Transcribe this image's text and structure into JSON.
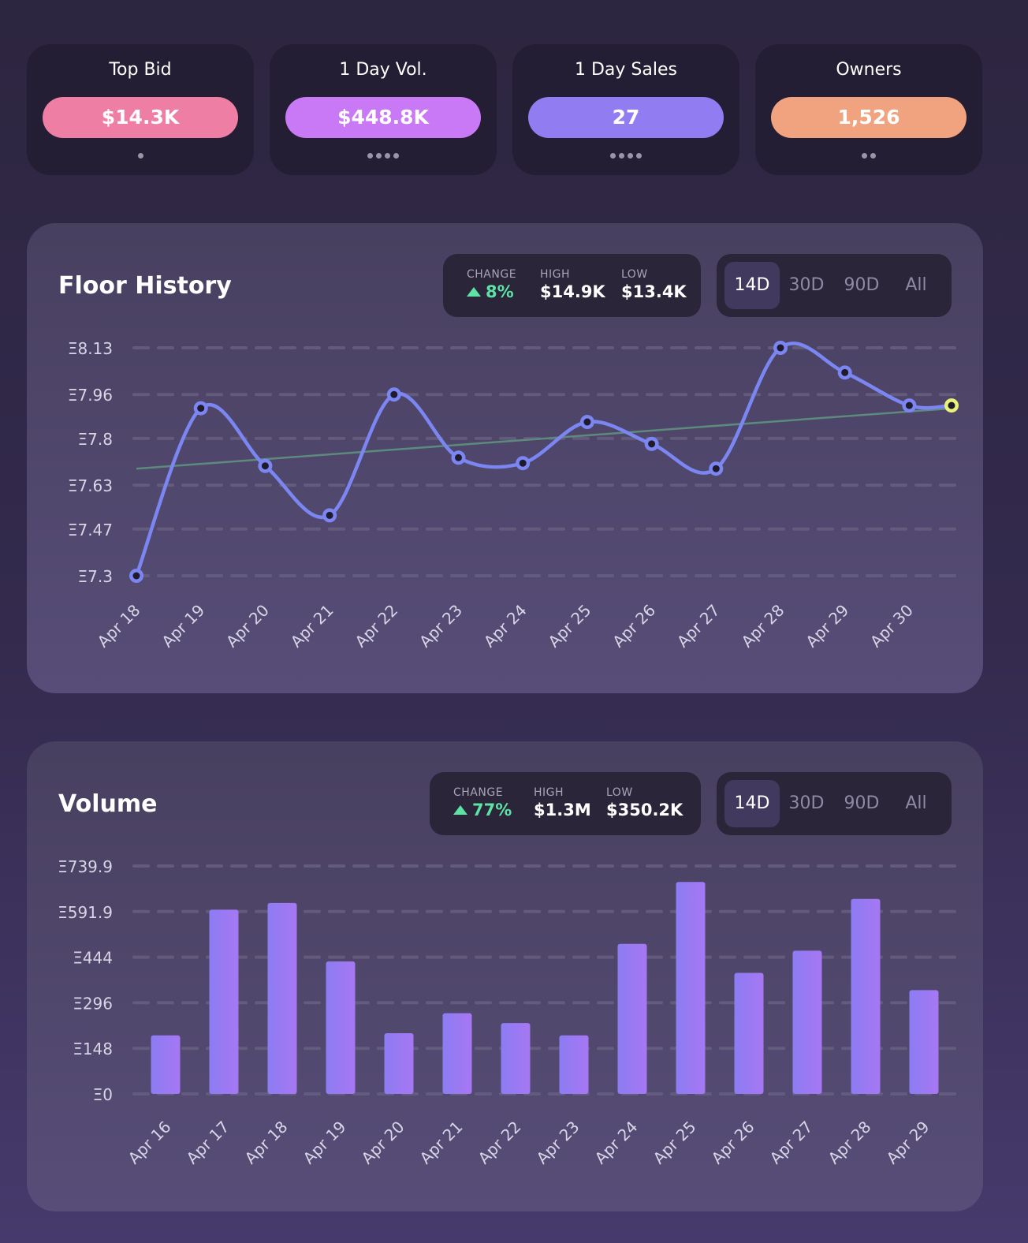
{
  "stats": [
    {
      "label": "Top Bid",
      "value": "$14.3K",
      "color": "#ee7ea4",
      "dots": 1
    },
    {
      "label": "1 Day Vol.",
      "value": "$448.8K",
      "color": "#c979f5",
      "dots": 4
    },
    {
      "label": "1 Day Sales",
      "value": "27",
      "color": "#927cf2",
      "dots": 4
    },
    {
      "label": "Owners",
      "value": "1,526",
      "color": "#f0a37e",
      "dots": 2
    }
  ],
  "floor": {
    "title": "Floor History",
    "summary": {
      "change_label": "CHANGE",
      "change_value": "8%",
      "high_label": "HIGH",
      "high_value": "$14.9K",
      "low_label": "LOW",
      "low_value": "$13.4K"
    },
    "ranges": [
      "14D",
      "30D",
      "90D",
      "All"
    ],
    "active_range": "14D"
  },
  "volume": {
    "title": "Volume",
    "summary": {
      "change_label": "CHANGE",
      "change_value": "77%",
      "high_label": "HIGH",
      "high_value": "$1.3M",
      "low_label": "LOW",
      "low_value": "$350.2K"
    },
    "ranges": [
      "14D",
      "30D",
      "90D",
      "All"
    ],
    "active_range": "14D"
  },
  "colors": {
    "line": "#7b86f2",
    "trend": "#5d8a7c",
    "last_point": "#e9f27b",
    "bar_start": "#8c7cf3",
    "bar_end": "#a777f3",
    "grid": "#6a6382"
  },
  "chart_data": [
    {
      "type": "line",
      "title": "Floor History",
      "x": [
        "Apr 18",
        "Apr 19",
        "Apr 20",
        "Apr 21",
        "Apr 22",
        "Apr 23",
        "Apr 24",
        "Apr 25",
        "Apr 26",
        "Apr 27",
        "Apr 28",
        "Apr 29",
        "Apr 30",
        "Apr 30"
      ],
      "x_tick_labels": [
        "Apr 18",
        "Apr 19",
        "Apr 20",
        "Apr 21",
        "Apr 22",
        "Apr 23",
        "Apr 24",
        "Apr 25",
        "Apr 26",
        "Apr 27",
        "Apr 28",
        "Apr 29",
        "Apr 30"
      ],
      "values": [
        7.3,
        7.91,
        7.7,
        7.52,
        7.96,
        7.73,
        7.71,
        7.86,
        7.78,
        7.69,
        8.13,
        8.04,
        7.92,
        7.92
      ],
      "y_ticks": [
        "Ξ8.13",
        "Ξ7.96",
        "Ξ7.8",
        "Ξ7.63",
        "Ξ7.47",
        "Ξ7.3"
      ],
      "y_tick_values": [
        8.13,
        7.96,
        7.8,
        7.63,
        7.47,
        7.3
      ],
      "ylim": [
        7.3,
        8.13
      ],
      "trend": [
        7.69,
        7.91
      ],
      "grid": true
    },
    {
      "type": "bar",
      "title": "Volume",
      "categories": [
        "Apr 16",
        "Apr 17",
        "Apr 18",
        "Apr 19",
        "Apr 20",
        "Apr 21",
        "Apr 22",
        "Apr 23",
        "Apr 24",
        "Apr 25",
        "Apr 26",
        "Apr 27",
        "Apr 28",
        "Apr 29"
      ],
      "values": [
        190,
        598,
        620,
        430,
        197,
        262,
        230,
        190,
        487,
        688,
        393,
        465,
        633,
        337
      ],
      "y_ticks": [
        "Ξ739.9",
        "Ξ591.9",
        "Ξ444",
        "Ξ296",
        "Ξ148",
        "Ξ0"
      ],
      "y_tick_values": [
        739.9,
        591.9,
        444,
        296,
        148,
        0
      ],
      "ylim": [
        0,
        739.9
      ],
      "grid": true
    }
  ]
}
